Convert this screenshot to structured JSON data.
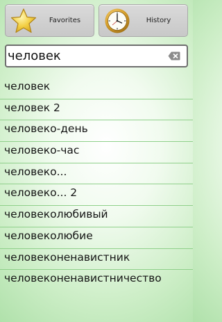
{
  "toolbar": {
    "favorites_label": "Favorites",
    "favorites_icon": "star-icon",
    "history_label": "History",
    "history_icon": "clock-icon"
  },
  "search": {
    "value": "человек",
    "clear_icon": "clear-text-icon"
  },
  "results": [
    "человек",
    "человек 2",
    "человеко-день",
    "человеко-час",
    "человеко...",
    "человеко... 2",
    "человеколюбивый",
    "человеколюбие",
    "человеконенавистник",
    "человеконенавистничество"
  ],
  "colors": {
    "background_center": "#ffffff",
    "background_edge": "#a9dea4",
    "divider": "#8fd08a",
    "button": "#d2d2d2",
    "star": "#f2cf3a",
    "clock_rim": "#c9952a"
  }
}
